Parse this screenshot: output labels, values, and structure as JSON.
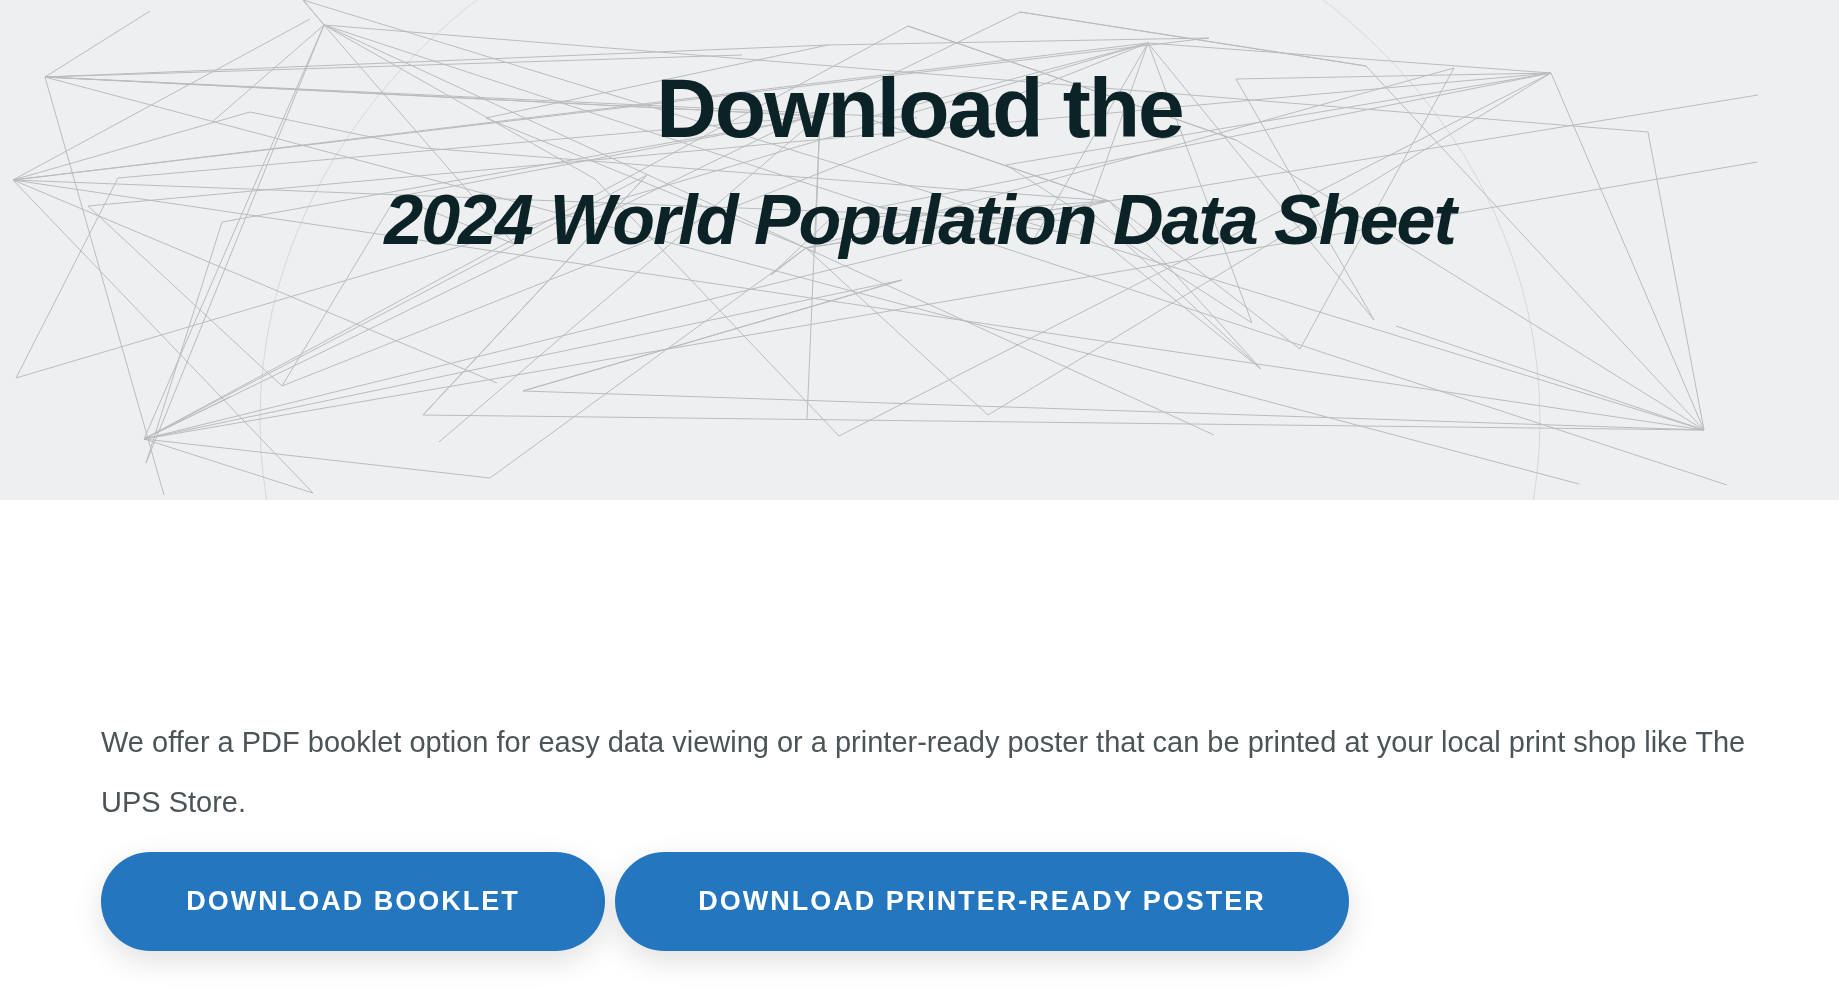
{
  "hero": {
    "title_line_1": "Download the",
    "title_line_2": "2024 World Population Data Sheet"
  },
  "description": "We offer a PDF booklet option for easy data viewing or a printer-ready poster that can be printed at your local print shop like The UPS Store.",
  "buttons": [
    {
      "label": "DOWNLOAD BOOKLET"
    },
    {
      "label": "DOWNLOAD PRINTER-READY POSTER"
    }
  ]
}
